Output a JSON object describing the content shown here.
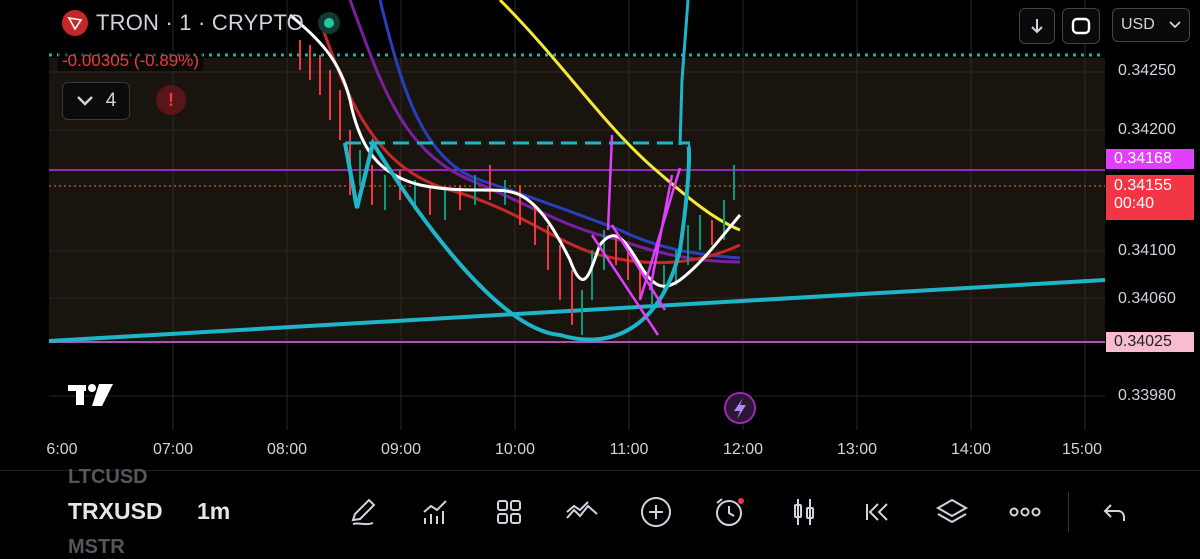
{
  "header": {
    "symbol_title": "TRON · 1 · CRYPTO",
    "change": "-0.00305 (-0.89%)",
    "indicator_count": "4",
    "currency": "USD"
  },
  "price_axis": {
    "labels": [
      "0.34250",
      "0.34200",
      "0.34100",
      "0.34060",
      "0.33980"
    ],
    "tags": [
      {
        "value": "0.34168",
        "color": "#e040fb"
      },
      {
        "value": "0.34155",
        "color": "#f23645",
        "countdown": "00:40"
      },
      {
        "value": "0.34025",
        "color": "#f48fb1"
      }
    ]
  },
  "time_axis": {
    "labels": [
      "6:00",
      "07:00",
      "08:00",
      "09:00",
      "10:00",
      "11:00",
      "12:00",
      "13:00",
      "14:00",
      "15:00"
    ]
  },
  "watchlist": {
    "above": "LTCUSD",
    "symbol": "TRXUSD",
    "timeframe": "1m",
    "below": "MSTR"
  },
  "toolbar": {
    "tools": [
      "draw-icon",
      "indicators-icon",
      "layouts-icon",
      "patterns-icon",
      "add-icon",
      "alert-clock-icon",
      "candles-icon",
      "replay-icon",
      "layers-icon",
      "more-icon",
      "undo-icon"
    ]
  },
  "colors": {
    "background": "#000000",
    "chart_area": "#1a140e",
    "cyan_drawing": "#1fb5c9",
    "magenta_drawing": "#e040fb",
    "yellow_ma": "#f3e936",
    "red_ma": "#c62828",
    "blue_ma": "#2a3fbf",
    "white_ma": "#ffffff"
  }
}
